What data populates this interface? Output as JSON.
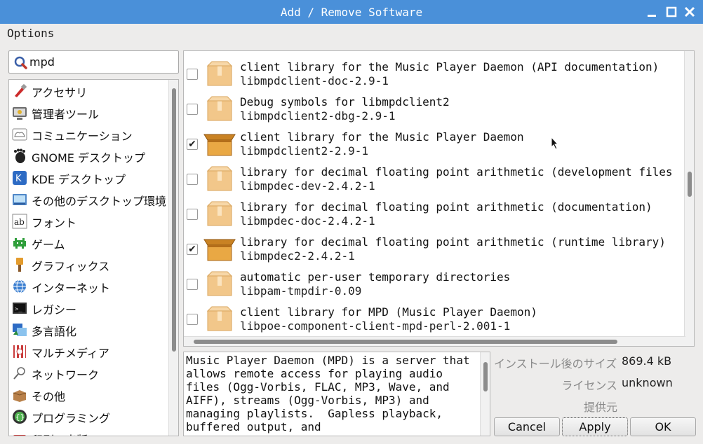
{
  "window": {
    "title": "Add / Remove Software",
    "controls": [
      "minimize-icon",
      "maximize-icon",
      "close-icon"
    ],
    "titlebar_color": "#4a90d9"
  },
  "menu": {
    "options_label": "Options"
  },
  "search": {
    "value": "mpd",
    "icon": "search-icon"
  },
  "categories": [
    {
      "label": "アクセサリ",
      "icon": "accessories-icon"
    },
    {
      "label": "管理者ツール",
      "icon": "admin-tools-icon"
    },
    {
      "label": "コミュニケーション",
      "icon": "communication-icon"
    },
    {
      "label": "GNOME デスクトップ",
      "icon": "gnome-icon"
    },
    {
      "label": "KDE デスクトップ",
      "icon": "kde-icon"
    },
    {
      "label": "その他のデスクトップ環境",
      "icon": "desktop-icon"
    },
    {
      "label": "フォント",
      "icon": "font-icon"
    },
    {
      "label": "ゲーム",
      "icon": "game-icon"
    },
    {
      "label": "グラフィックス",
      "icon": "graphics-icon"
    },
    {
      "label": "インターネット",
      "icon": "internet-icon"
    },
    {
      "label": "レガシー",
      "icon": "legacy-icon"
    },
    {
      "label": "多言語化",
      "icon": "localization-icon"
    },
    {
      "label": "マルチメディア",
      "icon": "multimedia-icon"
    },
    {
      "label": "ネットワーク",
      "icon": "network-icon"
    },
    {
      "label": "その他",
      "icon": "other-icon"
    },
    {
      "label": "プログラミング",
      "icon": "programming-icon"
    },
    {
      "label": "印刷・出版",
      "icon": "publishing-icon"
    }
  ],
  "packages": [
    {
      "description": "client library for the Music Player Daemon (API documentation)",
      "name": "libmpdclient-doc-2.9-1",
      "checked": false
    },
    {
      "description": "Debug symbols for libmpdclient2",
      "name": "libmpdclient2-dbg-2.9-1",
      "checked": false
    },
    {
      "description": "client library for the Music Player Daemon",
      "name": "libmpdclient2-2.9-1",
      "checked": true
    },
    {
      "description": "library for decimal floating point arithmetic (development files",
      "name": "libmpdec-dev-2.4.2-1",
      "checked": false
    },
    {
      "description": "library for decimal floating point arithmetic (documentation)",
      "name": "libmpdec-doc-2.4.2-1",
      "checked": false
    },
    {
      "description": "library for decimal floating point arithmetic (runtime library)",
      "name": "libmpdec2-2.4.2-1",
      "checked": true
    },
    {
      "description": "automatic per-user temporary directories",
      "name": "libpam-tmpdir-0.09",
      "checked": false
    },
    {
      "description": "client library for MPD (Music Player Daemon)",
      "name": "libpoe-component-client-mpd-perl-2.001-1",
      "checked": false
    }
  ],
  "details": {
    "description": "Music Player Daemon (MPD) is a server that allows remote access for playing audio files (Ogg-Vorbis, FLAC, MP3, Wave, and AIFF), streams (Ogg-Vorbis, MP3) and managing playlists.  Gapless playback, buffered output, and",
    "installed_size_label": "インストール後のサイズ",
    "installed_size_value": "869.4 kB",
    "license_label": "ライセンス",
    "license_value": "unknown",
    "provider_label": "提供元",
    "provider_value": ""
  },
  "buttons": {
    "cancel": "Cancel",
    "apply": "Apply",
    "ok": "OK"
  }
}
